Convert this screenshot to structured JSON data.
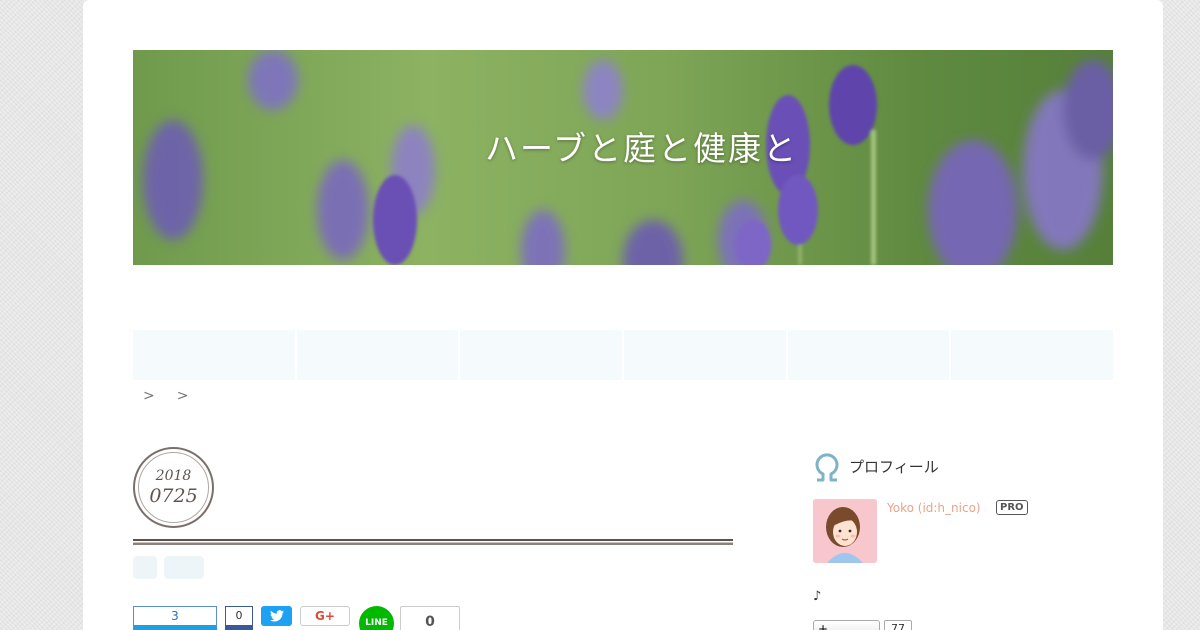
{
  "header": {
    "blog_title": "ハーブと庭と健康と"
  },
  "nav": {
    "items": [
      "",
      "",
      "",
      "",
      "",
      ""
    ]
  },
  "breadcrumb": {
    "separators": [
      ">",
      ">"
    ]
  },
  "entry": {
    "date_year": "2018",
    "date_month_day": "0725"
  },
  "share": {
    "hatena_count": "3",
    "facebook_count": "0",
    "tweet_icon": "twitter-bird-icon",
    "gplus_label": "G+",
    "line_label": "LINE",
    "pocket_count": "0"
  },
  "sidebar": {
    "profile_title": "プロフィール",
    "user_name": "Yoko (id:h_nico)",
    "pro_label": "PRO",
    "description": "♪",
    "follow_label": "+",
    "follow_count": "77"
  },
  "colors": {
    "accent": "#e8a58a",
    "nav_bg": "#f5fbfd",
    "profile_icon": "#7fb3c8"
  }
}
